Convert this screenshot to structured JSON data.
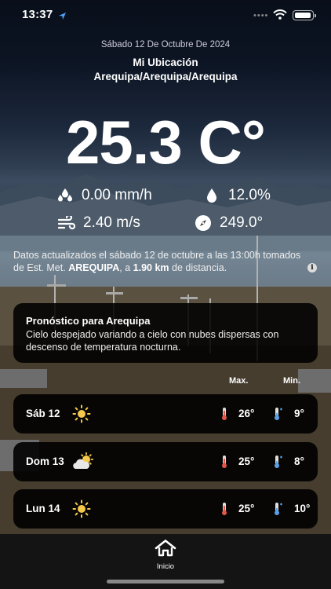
{
  "status_bar": {
    "time": "13:37"
  },
  "header": {
    "date": "Sábado 12 De Octubre De 2024",
    "location_title": "Mi Ubicación",
    "location_name": "Arequipa/Arequipa/Arequipa"
  },
  "current": {
    "temperature": "25.3 C°",
    "precipitation": "0.00 mm/h",
    "humidity": "12.0%",
    "wind_speed": "2.40 m/s",
    "wind_direction": "249.0°"
  },
  "update_note": {
    "prefix": "Datos actualizados el sábado 12 de octubre a las 13:00h tomados de Est. Met.",
    "station": "AREQUIPA",
    "middle": ", a",
    "distance": "1.90 km",
    "suffix": "de distancia."
  },
  "forecast": {
    "title": "Pronóstico para Arequipa",
    "description": "Cielo despejado variando a cielo con nubes dispersas con descenso de temperatura nocturna."
  },
  "daily_header": {
    "max": "Max.",
    "min": "Min."
  },
  "daily": [
    {
      "day": "Sáb 12",
      "icon": "sun-icon",
      "max": "26°",
      "min": "9°"
    },
    {
      "day": "Dom 13",
      "icon": "partly-cloudy-icon",
      "max": "25°",
      "min": "8°"
    },
    {
      "day": "Lun 14",
      "icon": "sun-icon",
      "max": "25°",
      "min": "10°"
    }
  ],
  "tabbar": {
    "home_label": "Inicio"
  },
  "colors": {
    "sun": "#f6c94a",
    "thermo_hot": "#e0574a",
    "thermo_cold": "#5aa0e8",
    "card_bg": "#000000"
  }
}
